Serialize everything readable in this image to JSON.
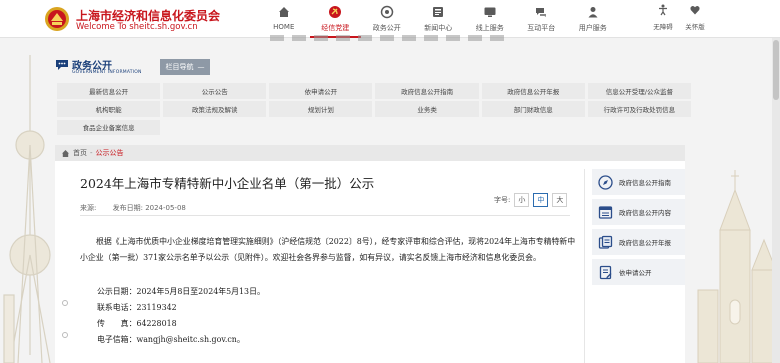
{
  "header": {
    "site_name_cn": "上海市经济和信息化委员会",
    "site_name_en": "Welcome To sheitc.sh.gov.cn",
    "nav": [
      {
        "label": "HOME",
        "icon": "home-icon"
      },
      {
        "label": "经信党建",
        "icon": "party-emblem-icon",
        "active": true
      },
      {
        "label": "政务公开",
        "icon": "gov-affairs-icon"
      },
      {
        "label": "新闻中心",
        "icon": "news-icon"
      },
      {
        "label": "线上服务",
        "icon": "online-service-icon"
      },
      {
        "label": "互动平台",
        "icon": "interaction-icon"
      },
      {
        "label": "用户服务",
        "icon": "user-service-icon"
      }
    ],
    "accessibility": [
      {
        "label": "无障碍",
        "icon": "accessibility-icon"
      },
      {
        "label": "关怀版",
        "icon": "care-version-icon"
      }
    ]
  },
  "gov": {
    "title_cn": "政务公开",
    "title_en": "GOVERNMENT INFORMATION",
    "nav_toggle_label": "栏目导航",
    "nav_toggle_symbol": "—",
    "grid": [
      [
        "最新信息公开",
        "公示公告",
        "依申请公开",
        "政府信息公开指南",
        "政府信息公开年报",
        "信息公开受理/公众监督"
      ],
      [
        "机构职能",
        "政策法规及解读",
        "规划计划",
        "业务类",
        "部门财政信息",
        "行政许可及行政处罚信息"
      ],
      [
        "食品企业备案信息"
      ]
    ]
  },
  "breadcrumb": {
    "home": "首页",
    "separator": "-",
    "current": "公示公告"
  },
  "article": {
    "title": "2024年上海市专精特新中小企业名单（第一批）公示",
    "source_label": "来源:",
    "date_label": "发布日期:",
    "date": "2024-05-08",
    "font_label": "字号:",
    "font_sizes": [
      "小",
      "中",
      "大"
    ],
    "selected_font": "中",
    "body": "根据《上海市优质中小企业梯度培育管理实施细则》（沪经信规范〔2022〕8号），经专家评审和综合评估，现将2024年上海市专精特新中小企业（第一批）371家公示名单予以公示（见附件）。欢迎社会各界参与监督，如有异议，请实名反馈上海市经济和信息化委员会。",
    "period_label": "公示日期：",
    "period": "2024年5月8日至2024年5月13日。",
    "phone_label": "联系电话：",
    "phone": "23119342",
    "fax_label": "传　　真：",
    "fax": "64228018",
    "email_label": "电子信箱：",
    "email": "wangjh@sheitc.sh.gov.cn。"
  },
  "sidebar_links": [
    {
      "label": "政府信息公开指南",
      "icon": "compass-icon"
    },
    {
      "label": "政府信息公开内容",
      "icon": "list-window-icon"
    },
    {
      "label": "政府信息公开年报",
      "icon": "annual-report-icon"
    },
    {
      "label": "依申请公开",
      "icon": "application-form-icon"
    }
  ],
  "colors": {
    "brand_red": "#c8161d",
    "gov_blue": "#1a3f7a",
    "link_blue": "#2b6cb0"
  }
}
